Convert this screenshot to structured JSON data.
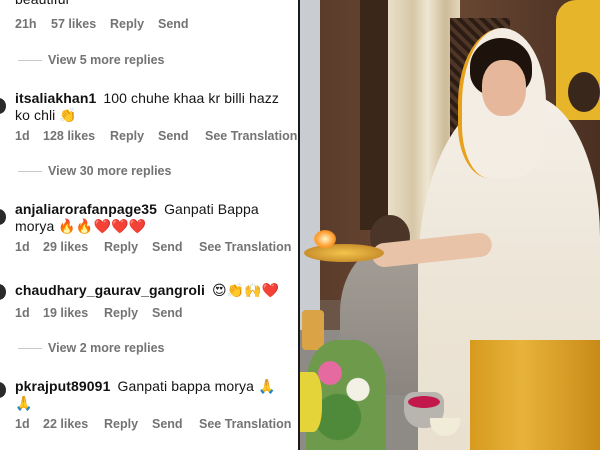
{
  "comments": [
    {
      "has_avatar": false,
      "username": "",
      "text": "beautiful",
      "meta": {
        "time": "21h",
        "likes": "57 likes",
        "reply": "Reply",
        "send": "Send",
        "translate": ""
      }
    },
    {
      "has_avatar": true,
      "username": "itsaliakhan1",
      "text": "100 chuhe khaa kr billi hazz ko chli 👏",
      "meta": {
        "time": "1d",
        "likes": "128 likes",
        "reply": "Reply",
        "send": "Send",
        "translate": "See Translation"
      }
    },
    {
      "has_avatar": true,
      "username": "anjaliarorafanpage35",
      "text": "Ganpati Bappa morya 🔥🔥❤️❤️❤️",
      "meta": {
        "time": "1d",
        "likes": "29 likes",
        "reply": "Reply",
        "send": "Send",
        "translate": "See Translation"
      }
    },
    {
      "has_avatar": true,
      "username": "chaudhary_gaurav_gangroli",
      "text": "😍👏🙌❤️",
      "meta": {
        "time": "1d",
        "likes": "19 likes",
        "reply": "Reply",
        "send": "Send",
        "translate": ""
      }
    },
    {
      "has_avatar": true,
      "username": "pkrajput89091",
      "text": "Ganpati bappa morya 🙏 🙏",
      "meta": {
        "time": "1d",
        "likes": "22 likes",
        "reply": "Reply",
        "send": "Send",
        "translate": "See Translation"
      }
    }
  ],
  "view_replies": [
    "View 5 more replies",
    "View 30 more replies",
    "View 2 more replies"
  ],
  "colors": {
    "meta_text": "#737373",
    "primary_text": "#111111",
    "divider": "#1a1a1a",
    "background": "#ffffff"
  },
  "icons": {
    "avatar": "avatar-circle",
    "reply_line": "horizontal-rule"
  }
}
